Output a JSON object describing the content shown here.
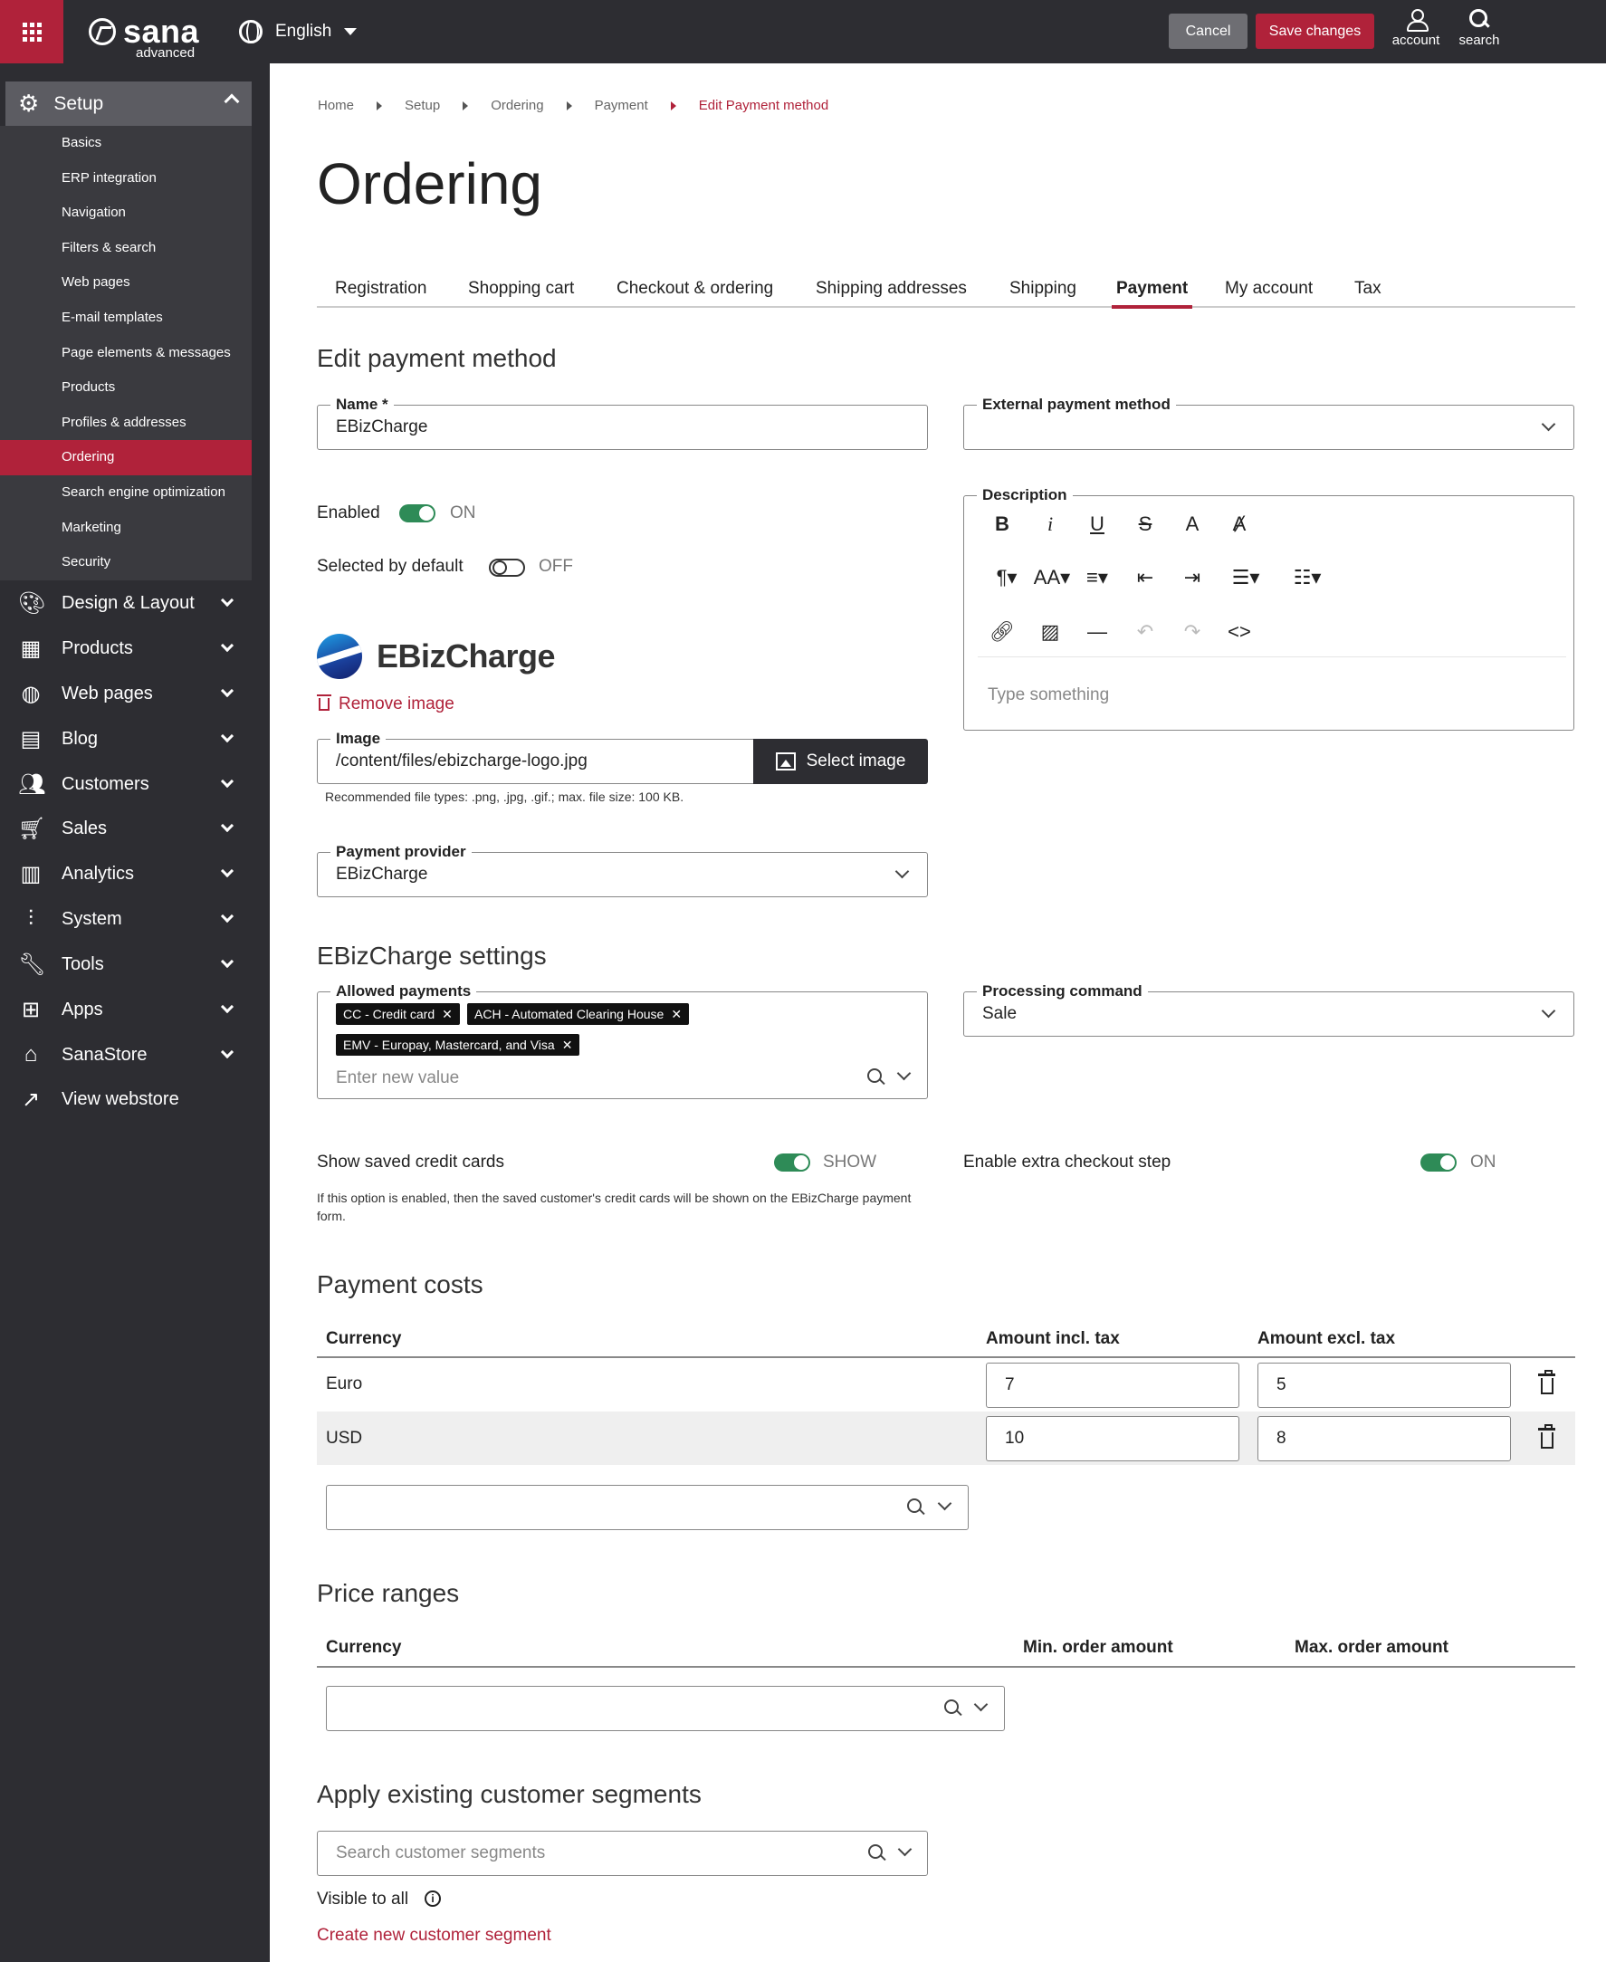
{
  "topbar": {
    "logo_name": "sana",
    "logo_sub": "advanced",
    "language": "English",
    "cancel_label": "Cancel",
    "save_label": "Save changes",
    "account_label": "account",
    "search_label": "search",
    "accent_color": "#b0223a"
  },
  "sidebar": {
    "section": "Setup",
    "sub_items": [
      {
        "label": "Basics"
      },
      {
        "label": "ERP integration"
      },
      {
        "label": "Navigation"
      },
      {
        "label": "Filters & search"
      },
      {
        "label": "Web pages"
      },
      {
        "label": "E-mail templates"
      },
      {
        "label": "Page elements & messages"
      },
      {
        "label": "Products"
      },
      {
        "label": "Profiles & addresses"
      },
      {
        "label": "Ordering"
      },
      {
        "label": "Search engine optimization"
      },
      {
        "label": "Marketing"
      },
      {
        "label": "Security"
      }
    ],
    "active_sub_item": "Ordering",
    "main_items": [
      {
        "label": "Design & Layout",
        "icon": "palette-icon"
      },
      {
        "label": "Products",
        "icon": "qr-grid-icon"
      },
      {
        "label": "Web pages",
        "icon": "globe-icon"
      },
      {
        "label": "Blog",
        "icon": "blog-icon"
      },
      {
        "label": "Customers",
        "icon": "people-icon"
      },
      {
        "label": "Sales",
        "icon": "cart-icon"
      },
      {
        "label": "Analytics",
        "icon": "chart-icon"
      },
      {
        "label": "System",
        "icon": "sliders-icon"
      },
      {
        "label": "Tools",
        "icon": "wrench-icon"
      },
      {
        "label": "Apps",
        "icon": "apps-icon"
      },
      {
        "label": "SanaStore",
        "icon": "store-icon"
      },
      {
        "label": "View webstore",
        "icon": "external-link-icon"
      }
    ]
  },
  "breadcrumb": [
    "Home",
    "Setup",
    "Ordering",
    "Payment",
    "Edit Payment method"
  ],
  "page_title": "Ordering",
  "tabs": [
    "Registration",
    "Shopping cart",
    "Checkout & ordering",
    "Shipping addresses",
    "Shipping",
    "Payment",
    "My account",
    "Tax"
  ],
  "active_tab": "Payment",
  "edit": {
    "title": "Edit payment method",
    "name_label": "Name *",
    "name_value": "EBizCharge",
    "external_label": "External payment method",
    "external_value": "",
    "enabled_label": "Enabled",
    "enabled_state": "ON",
    "selected_default_label": "Selected by default",
    "selected_default_state": "OFF",
    "description_label": "Description",
    "description_placeholder": "Type something",
    "logo_text": "EBizCharge",
    "remove_image": "Remove image",
    "image_label": "Image",
    "image_value": "/content/files/ebizcharge-logo.jpg",
    "select_image": "Select image",
    "image_hint": "Recommended file types: .png, .jpg, .gif.; max. file size: 100 KB.",
    "provider_label": "Payment provider",
    "provider_value": "EBizCharge"
  },
  "settings": {
    "title": "EBizCharge settings",
    "allowed_label": "Allowed payments",
    "allowed_tags": [
      "CC - Credit card",
      "ACH - Automated Clearing House",
      "EMV - Europay, Mastercard, and Visa"
    ],
    "allowed_placeholder": "Enter new value",
    "processing_label": "Processing command",
    "processing_value": "Sale",
    "saved_cards_label": "Show saved credit cards",
    "saved_cards_state": "SHOW",
    "saved_cards_hint": "If this option is enabled, then the saved customer's credit cards will be shown on the EBizCharge payment form.",
    "extra_step_label": "Enable extra checkout step",
    "extra_step_state": "ON"
  },
  "costs": {
    "title": "Payment costs",
    "headers": [
      "Currency",
      "Amount incl. tax",
      "Amount excl. tax"
    ],
    "rows": [
      {
        "currency": "Euro",
        "incl": "7",
        "excl": "5"
      },
      {
        "currency": "USD",
        "incl": "10",
        "excl": "8"
      }
    ]
  },
  "ranges": {
    "title": "Price ranges",
    "headers": [
      "Currency",
      "Min. order amount",
      "Max. order amount"
    ]
  },
  "segments": {
    "title": "Apply existing customer segments",
    "placeholder": "Search customer segments",
    "visible_label": "Visible to all",
    "create_link": "Create new customer segment"
  }
}
